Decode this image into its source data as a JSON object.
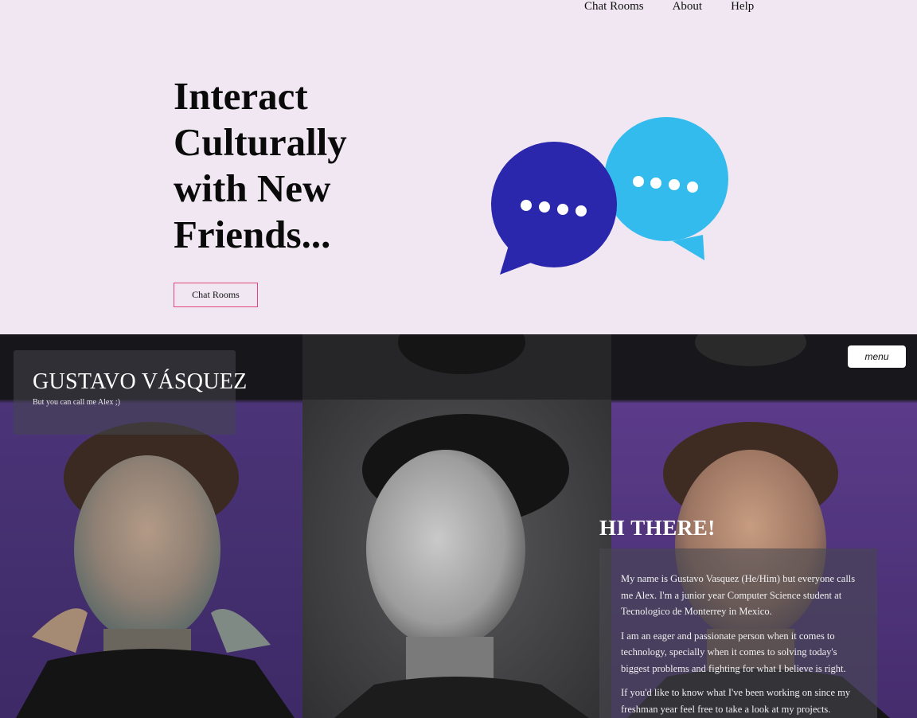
{
  "nav": {
    "items": [
      "Chat Rooms",
      "About",
      "Help"
    ]
  },
  "hero": {
    "title_lines": [
      "Interact",
      "Culturally",
      "with New",
      "Friends..."
    ],
    "cta_label": "Chat Rooms"
  },
  "colors": {
    "background": "#f1e7f3",
    "bubble_dark": "#2a27ad",
    "bubble_light": "#34bbee",
    "cta_border": "#e0467a",
    "portrait_accent": "#5b3b8a"
  },
  "profile": {
    "name": "GUSTAVO VÁSQUEZ",
    "tagline": "But you can call me Alex ;)",
    "menu_label": "menu",
    "greeting": "HI THERE!",
    "paragraphs": [
      "My name is Gustavo Vasquez (He/Him) but everyone calls me Alex. I'm a junior year Computer Science student at Tecnologico de Monterrey in Mexico.",
      "I am an eager and passionate person when it comes to technology, specially when it comes to solving today's biggest problems and fighting for what I believe is right.",
      "If you'd like to know what I've been working on since my freshman year feel free to take a look at my projects."
    ]
  }
}
